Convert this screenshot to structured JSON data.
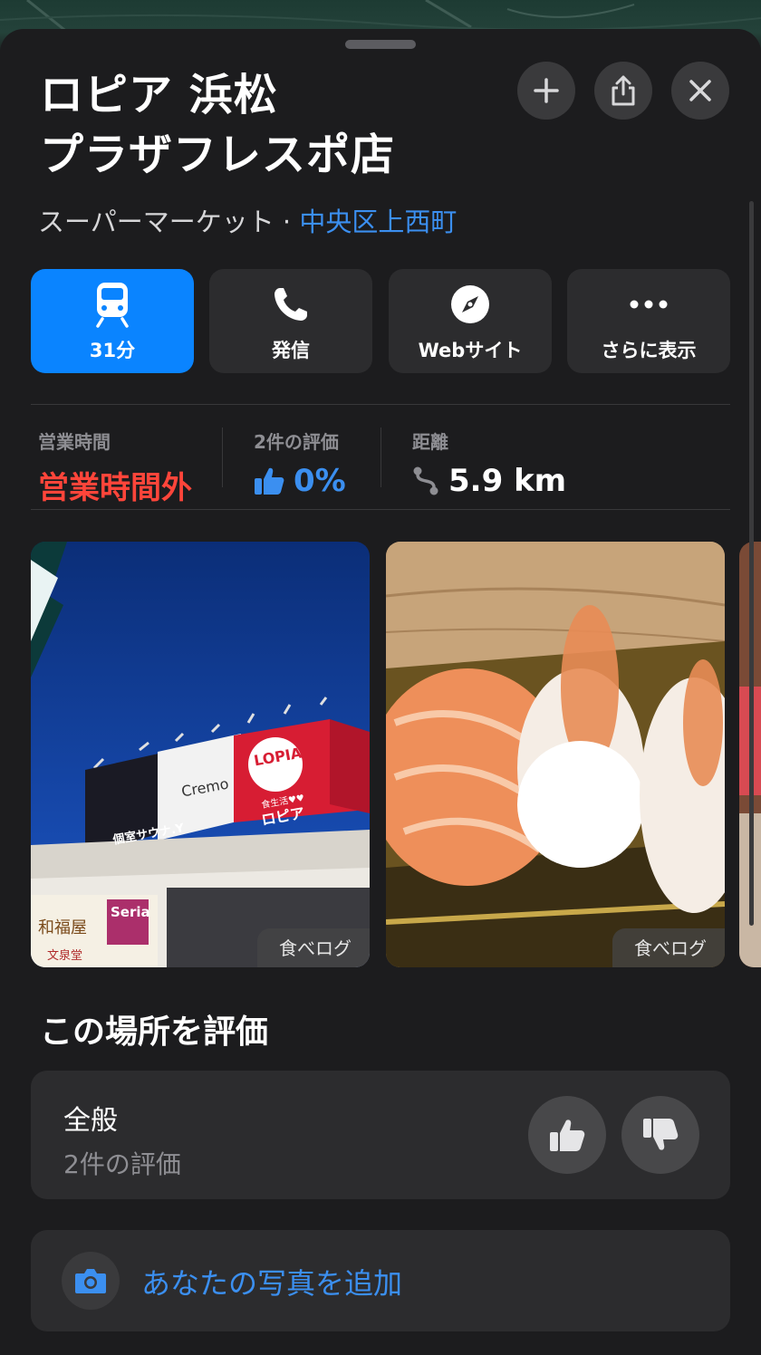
{
  "place": {
    "name_line1": "ロピア 浜松",
    "name_line2": "プラザフレスポ店",
    "category": "スーパーマーケット · ",
    "area": "中央区上西町"
  },
  "top_buttons": {
    "add_icon": "plus-icon",
    "share_icon": "share-icon",
    "close_icon": "close-icon"
  },
  "actions": [
    {
      "label": "31分",
      "icon": "train-icon"
    },
    {
      "label": "発信",
      "icon": "phone-icon"
    },
    {
      "label": "Webサイト",
      "icon": "compass-icon"
    },
    {
      "label": "さらに表示",
      "icon": "more-icon"
    }
  ],
  "info": {
    "hours_label": "営業時間",
    "hours_value": "営業時間外",
    "rating_label": "2件の評価",
    "rating_value": "0%",
    "distance_label": "距離",
    "distance_value": "5.9 km"
  },
  "photos": [
    {
      "source": "食べログ"
    },
    {
      "source": "食べログ"
    }
  ],
  "storefront_signs": {
    "cremo": "Cremo",
    "lopia": "LOPIA",
    "lopia_jp": "ロピア",
    "lopia_small": "食生活♥♥",
    "sauna": "個室サウナ.Y",
    "seria": "Seria",
    "wafukuya": "和福屋",
    "bunkado": "文泉堂"
  },
  "rate": {
    "section_title": "この場所を評価",
    "overall_label": "全般",
    "overall_count": "2件の評価"
  },
  "add_photo": {
    "label": "あなたの写真を追加"
  },
  "colors": {
    "accent": "#0a84ff",
    "link": "#3b8ff0",
    "closed_red": "#ff453a",
    "background": "#1c1c1e",
    "card": "#2c2c2e"
  }
}
